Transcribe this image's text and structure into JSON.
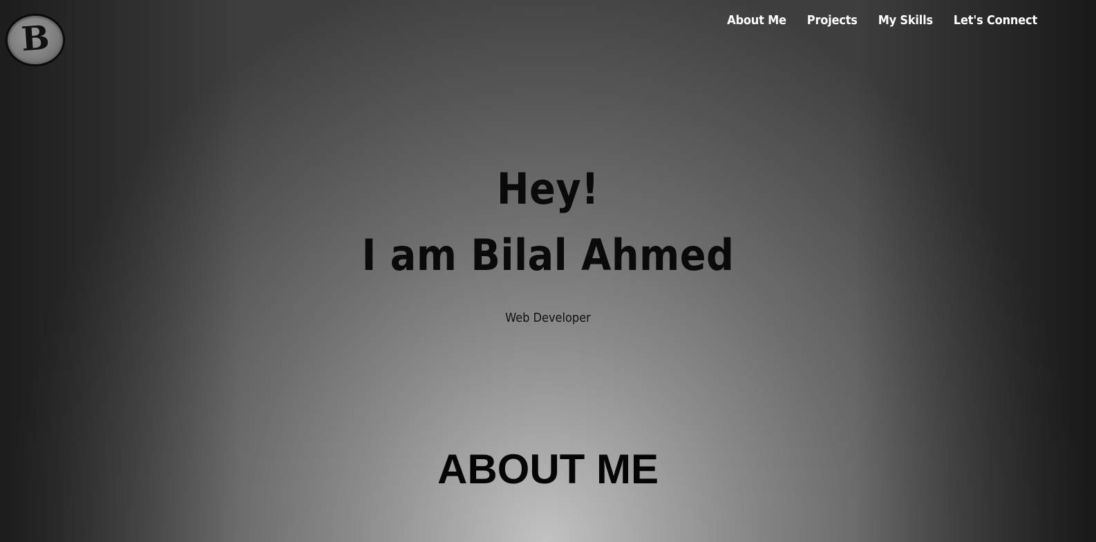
{
  "header": {
    "logo_letter": "B",
    "nav": [
      {
        "label": "About Me"
      },
      {
        "label": "Projects"
      },
      {
        "label": "My Skills"
      },
      {
        "label": "Let's Connect"
      }
    ]
  },
  "hero": {
    "greeting": "Hey!",
    "name_line": "I am Bilal Ahmed",
    "subtitle": "Web Developer"
  },
  "about": {
    "title": "ABOUT ME"
  },
  "colors": {
    "text_dark": "#0a0a0a",
    "nav_text": "#ffffff",
    "bg_center": "#c2c2c2",
    "bg_edge": "#1c1c1c"
  }
}
